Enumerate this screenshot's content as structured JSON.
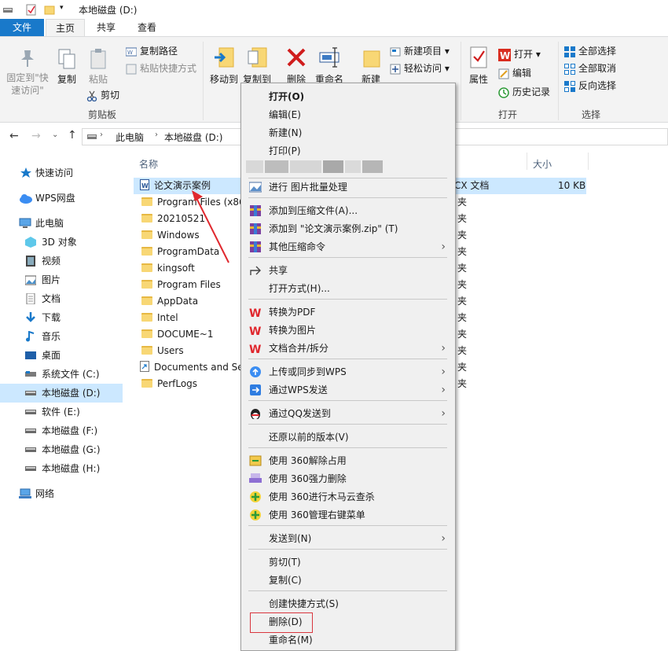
{
  "window": {
    "title": "本地磁盘 (D:)"
  },
  "tabs": {
    "file": "文件",
    "home": "主页",
    "share": "共享",
    "view": "查看"
  },
  "ribbon": {
    "pin_quick_access": [
      "固定到\"快",
      "速访问\""
    ],
    "copy": "复制",
    "paste": "粘贴",
    "copy_path": "复制路径",
    "paste_shortcut": "粘贴快捷方式",
    "cut": "剪切",
    "clipboard_group": "剪贴板",
    "move_to": "移动到",
    "copy_to": "复制到",
    "delete": "删除",
    "rename": "重命名",
    "new_folder": "新建",
    "new_item": "新建项目",
    "easy_access": "轻松访问",
    "properties": "属性",
    "open": "打开",
    "edit": "编辑",
    "history": "历史记录",
    "open_group": "打开",
    "select_all": "全部选择",
    "select_none": "全部取消",
    "invert_selection": "反向选择",
    "select_group": "选择"
  },
  "address": {
    "this_pc": "此电脑",
    "drive": "本地磁盘 (D:)"
  },
  "nav": {
    "quick_access": "快速访问",
    "wps_drive": "WPS网盘",
    "this_pc": "此电脑",
    "objects3d": "3D 对象",
    "videos": "视频",
    "pictures": "图片",
    "documents": "文档",
    "downloads": "下载",
    "music": "音乐",
    "desktop": "桌面",
    "drive_c": "系统文件 (C:)",
    "drive_d": "本地磁盘 (D:)",
    "drive_e": "软件 (E:)",
    "drive_f": "本地磁盘 (F:)",
    "drive_g": "本地磁盘 (G:)",
    "drive_h": "本地磁盘 (H:)",
    "network": "网络"
  },
  "columns": {
    "name": "名称",
    "size": "大小"
  },
  "files": [
    {
      "name": "论文演示案例",
      "type": "CX 文档",
      "size": "10 KB"
    },
    {
      "name": "Program Files (x86",
      "type": "夹"
    },
    {
      "name": "20210521",
      "type": "夹"
    },
    {
      "name": "Windows",
      "type": "夹"
    },
    {
      "name": "ProgramData",
      "type": "夹"
    },
    {
      "name": "kingsoft",
      "type": "夹"
    },
    {
      "name": "Program Files",
      "type": "夹"
    },
    {
      "name": "AppData",
      "type": "夹"
    },
    {
      "name": "Intel",
      "type": "夹"
    },
    {
      "name": "DOCUME~1",
      "type": "夹"
    },
    {
      "name": "Users",
      "type": "夹"
    },
    {
      "name": "Documents and Se",
      "type": "夹"
    },
    {
      "name": "PerfLogs",
      "type": "夹"
    }
  ],
  "context_menu": {
    "open": "打开(O)",
    "edit": "编辑(E)",
    "new": "新建(N)",
    "print": "打印(P)",
    "batch_image": "进行 图片批量处理",
    "add_archive": "添加到压缩文件(A)...",
    "add_zip": "添加到 \"论文演示案例.zip\" (T)",
    "other_compress": "其他压缩命令",
    "share": "共享",
    "open_with": "打开方式(H)...",
    "to_pdf": "转换为PDF",
    "to_image": "转换为图片",
    "merge_split": "文档合并/拆分",
    "upload_wps": "上传或同步到WPS",
    "send_wps": "通过WPS发送",
    "send_qq": "通过QQ发送到",
    "restore_versions": "还原以前的版本(V)",
    "unlock_360": "使用 360解除占用",
    "force_delete_360": "使用 360强力删除",
    "trojan_scan_360": "使用 360进行木马云查杀",
    "manage_menu_360": "使用 360管理右键菜单",
    "send_to": "发送到(N)",
    "cut": "剪切(T)",
    "copy": "复制(C)",
    "create_shortcut": "创建快捷方式(S)",
    "delete": "删除(D)",
    "rename": "重命名(M)"
  },
  "colors": {
    "accent": "#1979ca",
    "selection": "#cce8ff",
    "highlight_red": "#d9363e",
    "arrow_red": "#e0282e"
  }
}
